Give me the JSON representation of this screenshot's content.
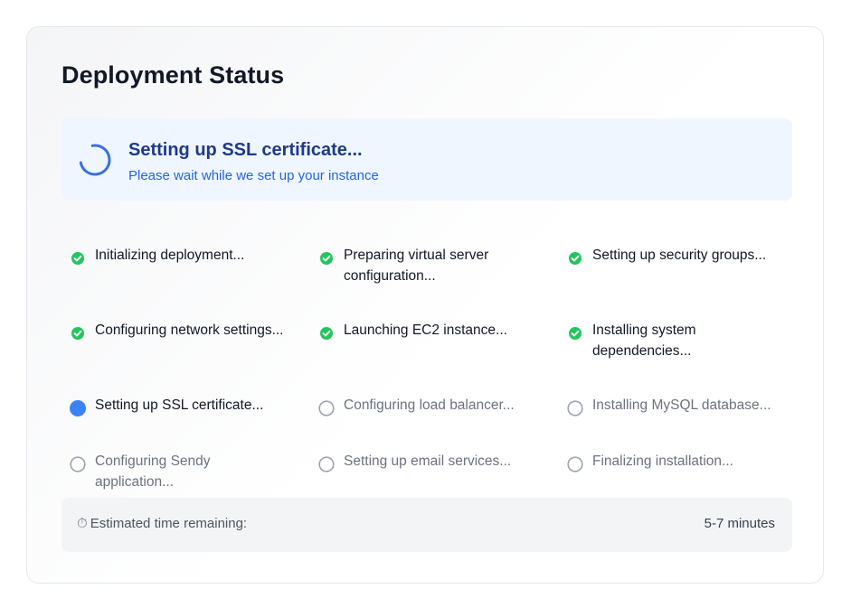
{
  "page": {
    "title": "Deployment Status"
  },
  "status": {
    "title": "Setting up SSL certificate...",
    "subtitle": "Please wait while we set up your instance"
  },
  "steps": [
    {
      "label": "Initializing deployment...",
      "state": "done"
    },
    {
      "label": "Preparing virtual server configuration...",
      "state": "done"
    },
    {
      "label": "Setting up security groups...",
      "state": "done"
    },
    {
      "label": "Configuring network settings...",
      "state": "done"
    },
    {
      "label": "Launching EC2 instance...",
      "state": "done"
    },
    {
      "label": "Installing system dependencies...",
      "state": "done"
    },
    {
      "label": "Setting up SSL certificate...",
      "state": "active"
    },
    {
      "label": "Configuring load balancer...",
      "state": "pending"
    },
    {
      "label": "Installing MySQL database...",
      "state": "pending"
    },
    {
      "label": "Configuring Sendy application...",
      "state": "pending"
    },
    {
      "label": "Setting up email services...",
      "state": "pending"
    },
    {
      "label": "Finalizing installation...",
      "state": "pending"
    }
  ],
  "footer": {
    "eta_icon": "stopwatch-icon",
    "eta_icon_glyph": "⏱",
    "eta_label": "Estimated time remaining:",
    "eta_value": "5-7 minutes"
  },
  "colors": {
    "done": "#22c55e",
    "active": "#3b82f6",
    "pending_ring": "#9ca3af",
    "spinner": "#3b6fe0",
    "banner_bg": "#eff6ff",
    "banner_title": "#1e3a8a",
    "banner_sub": "#2563eb"
  }
}
